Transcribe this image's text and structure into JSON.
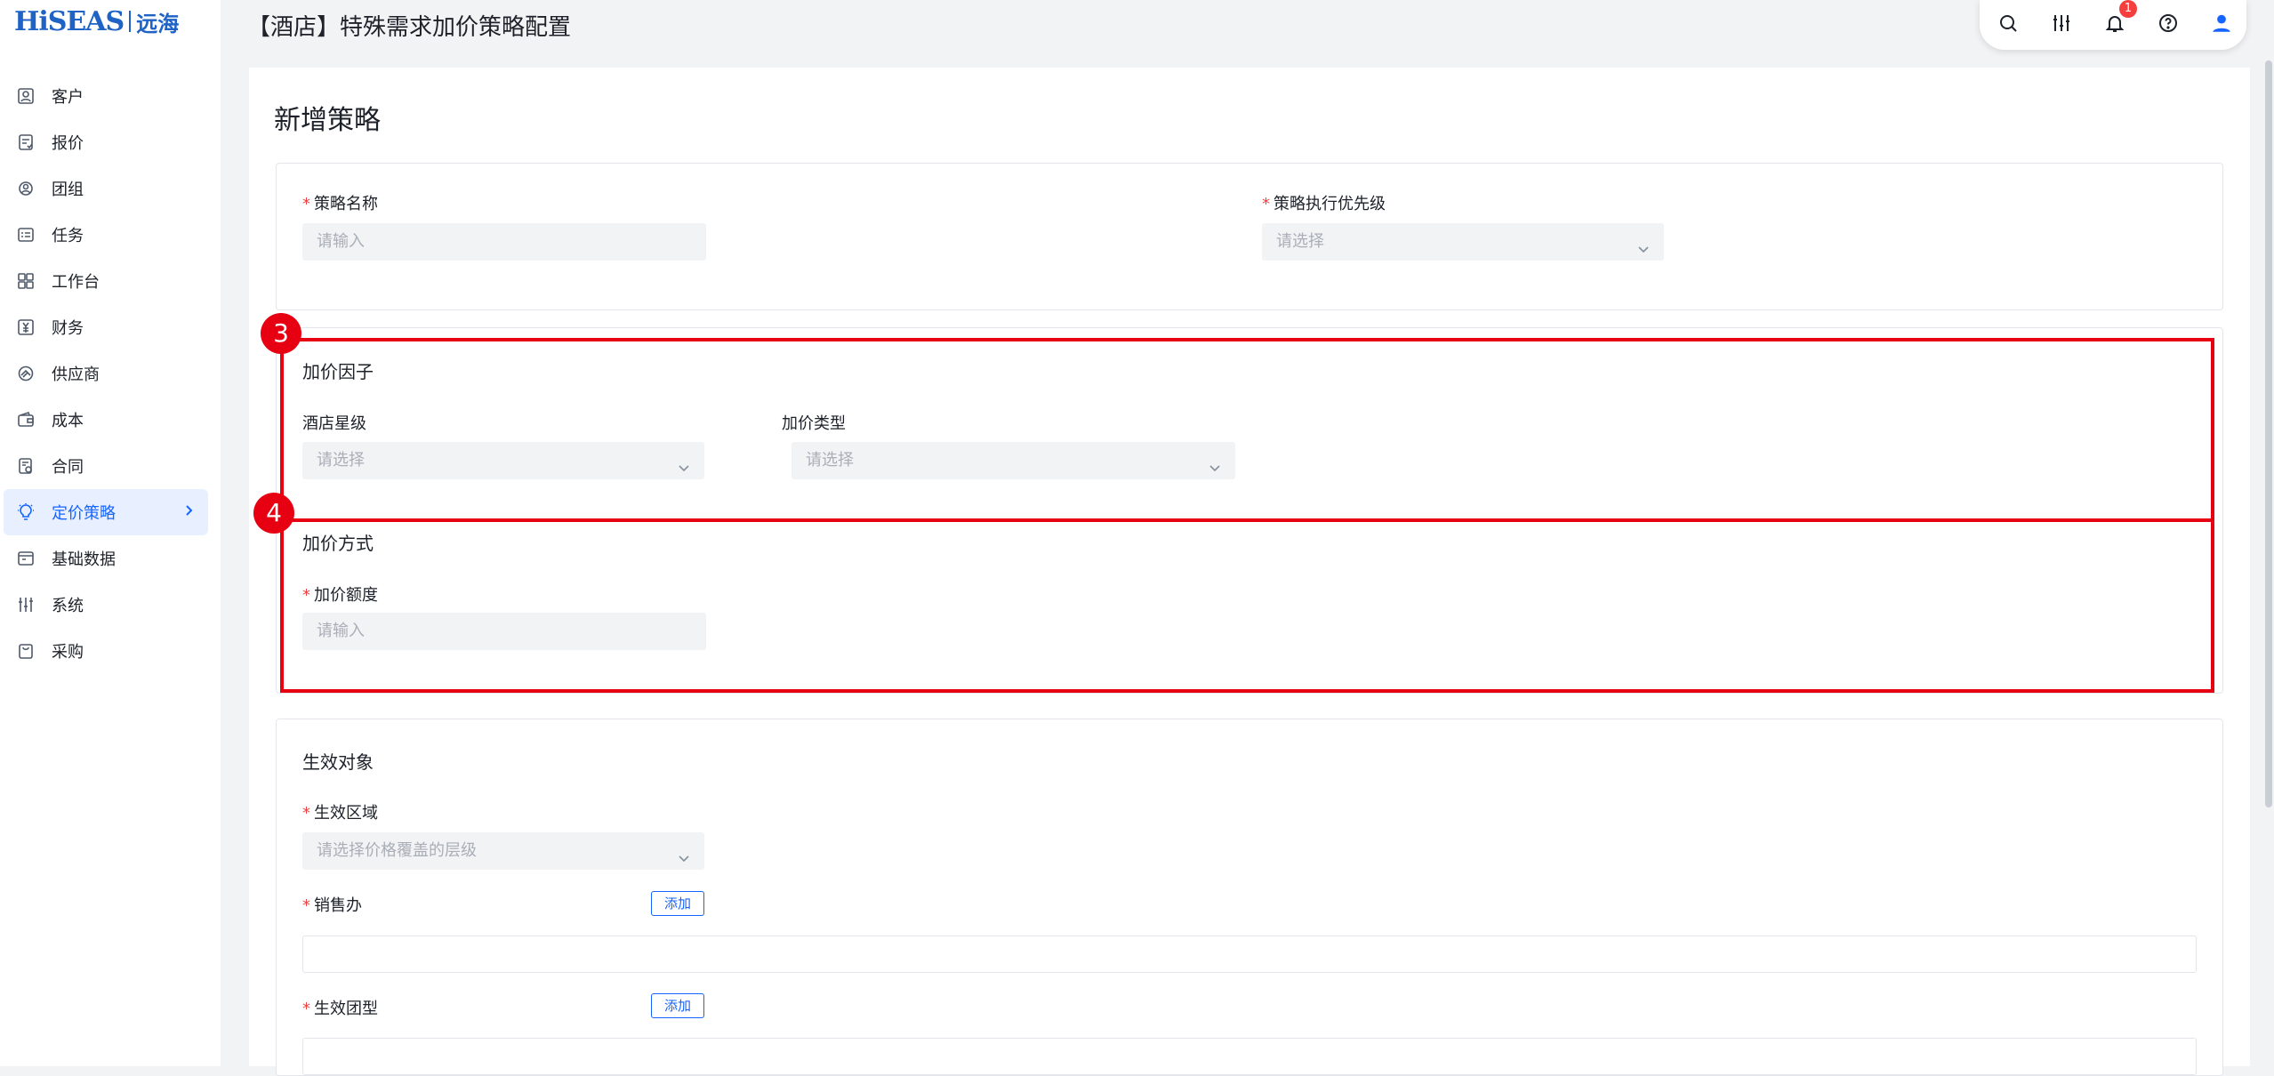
{
  "brand": {
    "logo_main": "HiSEAS",
    "logo_cn": "远海"
  },
  "sidebar": {
    "items": [
      {
        "label": "客户",
        "icon": "customer-icon"
      },
      {
        "label": "报价",
        "icon": "quote-icon"
      },
      {
        "label": "团组",
        "icon": "group-icon"
      },
      {
        "label": "任务",
        "icon": "task-icon"
      },
      {
        "label": "工作台",
        "icon": "dashboard-icon"
      },
      {
        "label": "财务",
        "icon": "finance-icon"
      },
      {
        "label": "供应商",
        "icon": "supplier-icon"
      },
      {
        "label": "成本",
        "icon": "wallet-icon"
      },
      {
        "label": "合同",
        "icon": "contract-icon"
      },
      {
        "label": "定价策略",
        "icon": "bulb-icon",
        "active": true
      },
      {
        "label": "基础数据",
        "icon": "folder-icon"
      },
      {
        "label": "系统",
        "icon": "settings-sliders-icon"
      },
      {
        "label": "采购",
        "icon": "shopping-bag-icon"
      }
    ]
  },
  "header": {
    "title": "【酒店】特殊需求加价策略配置",
    "notification_count": "1",
    "tools": [
      "search-icon",
      "sliders-icon",
      "bell-icon",
      "help-icon",
      "user-icon"
    ]
  },
  "form": {
    "title": "新增策略",
    "basic": {
      "name_label": "策略名称",
      "name_placeholder": "请输入",
      "priority_label": "策略执行优先级",
      "priority_placeholder": "请选择"
    },
    "factor": {
      "title": "加价因子",
      "star_label": "酒店星级",
      "star_placeholder": "请选择",
      "type_label": "加价类型",
      "type_placeholder": "请选择"
    },
    "method": {
      "title": "加价方式",
      "amount_label": "加价额度",
      "amount_placeholder": "请输入"
    },
    "target": {
      "title": "生效对象",
      "region_label": "生效区域",
      "region_placeholder": "请选择价格覆盖的层级",
      "office_label": "销售办",
      "office_add": "添加",
      "group_type_label": "生效团型",
      "group_type_add": "添加"
    }
  },
  "annotations": {
    "marker_3": "3",
    "marker_4": "4",
    "color": "#e60012"
  },
  "colors": {
    "primary": "#1664ff",
    "required": "#f53f3f",
    "input_bg": "#f2f3f5"
  }
}
